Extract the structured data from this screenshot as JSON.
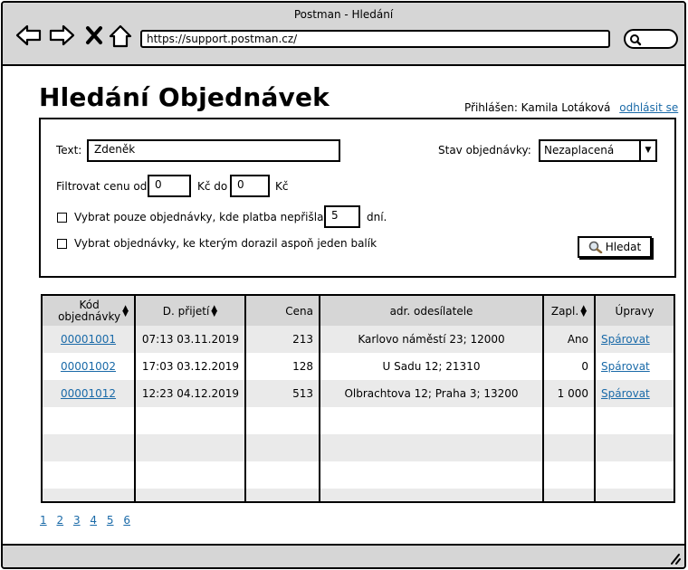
{
  "window": {
    "title": "Postman - Hledání"
  },
  "browser": {
    "url": "https://support.postman.cz/"
  },
  "page": {
    "title": "Hledání Objednávek",
    "logged_in_label": "Přihlášen: Kamila Lotáková",
    "logout_link": "odhlásit se"
  },
  "filters": {
    "text_label": "Text:",
    "text_value": "Zdeněk",
    "status_label": "Stav objednávky:",
    "status_value": "Nezaplacená",
    "price_label": "Filtrovat cenu od:",
    "price_from": "0",
    "price_mid": "Kč do",
    "price_to": "0",
    "price_unit": "Kč",
    "unpaid_label": "Vybrat pouze objednávky, kde platba nepřišla",
    "unpaid_days": "5",
    "days_unit": "dní.",
    "package_label": "Vybrat objednávky, ke kterým dorazil aspoň jeden balík",
    "search_button": "Hledat"
  },
  "table": {
    "headers": {
      "code_line1": "Kód",
      "code_line2": "objednávky",
      "date": "D. přijetí",
      "price": "Cena",
      "address": "adr. odesílatele",
      "paid": "Zapl.",
      "edit": "Úpravy"
    },
    "rows": [
      {
        "code": "00001001",
        "date": "07:13 03.11.2019",
        "price": "213",
        "address": "Karlovo náměstí 23; 12000",
        "paid": "Ano",
        "action": "Spárovat"
      },
      {
        "code": "00001002",
        "date": "17:03 03.12.2019",
        "price": "128",
        "address": "U Sadu 12; 21310",
        "paid": "0",
        "action": "Spárovat"
      },
      {
        "code": "00001012",
        "date": "12:23 04.12.2019",
        "price": "513",
        "address": "Olbrachtova 12; Praha 3; 13200",
        "paid": "1 000",
        "action": "Spárovat"
      }
    ]
  },
  "pagination": {
    "pages": [
      "1",
      "2",
      "3",
      "4",
      "5",
      "6"
    ]
  }
}
